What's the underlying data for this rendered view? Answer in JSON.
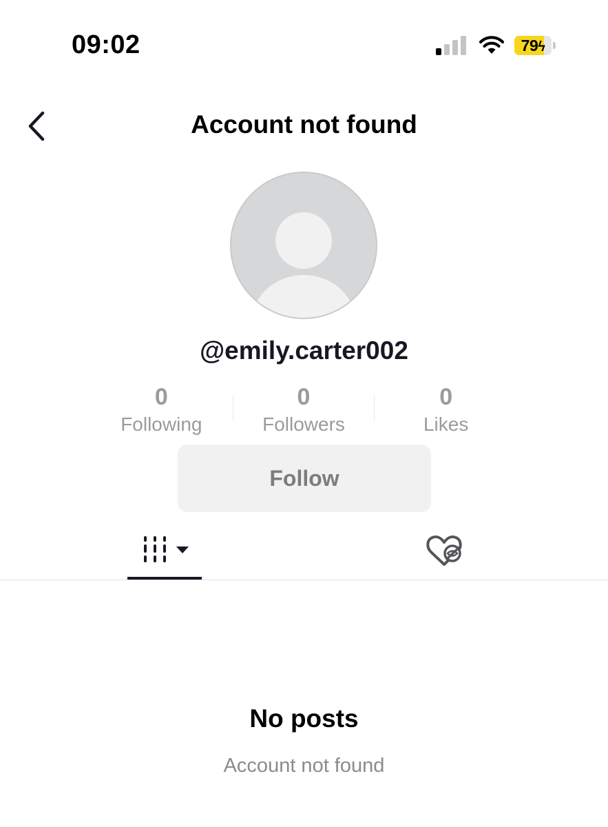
{
  "status_bar": {
    "time": "09:02",
    "battery_level": "79",
    "battery_fraction": 0.79,
    "battery_charging": true,
    "signal_bars_active": 1,
    "signal_bars_total": 4,
    "battery_color": "#f7d51d"
  },
  "header": {
    "back_icon": "chevron-left-icon",
    "title": "Account not found"
  },
  "profile": {
    "avatar_icon": "default-avatar-icon",
    "username": "@emily.carter002",
    "stats": [
      {
        "value": "0",
        "label": "Following"
      },
      {
        "value": "0",
        "label": "Followers"
      },
      {
        "value": "0",
        "label": "Likes"
      }
    ],
    "follow_label": "Follow"
  },
  "tabs": {
    "videos_icon": "video-grid-icon",
    "dropdown_icon": "caret-down-icon",
    "liked_icon": "hidden-liked-icon",
    "active": "videos"
  },
  "empty_state": {
    "title": "No posts",
    "subtitle": "Account not found"
  }
}
